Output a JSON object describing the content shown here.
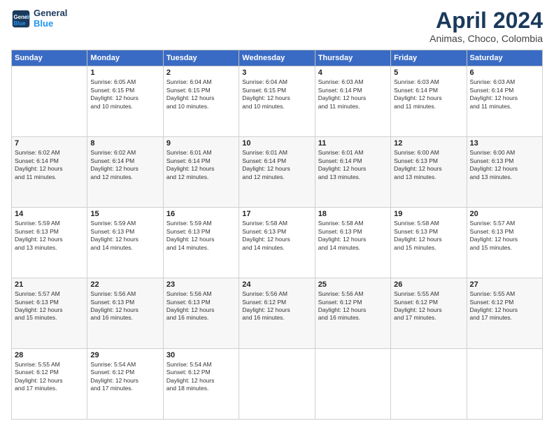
{
  "header": {
    "logo_line1": "General",
    "logo_line2": "Blue",
    "month_year": "April 2024",
    "location": "Animas, Choco, Colombia"
  },
  "columns": [
    "Sunday",
    "Monday",
    "Tuesday",
    "Wednesday",
    "Thursday",
    "Friday",
    "Saturday"
  ],
  "weeks": [
    [
      {
        "day": "",
        "content": ""
      },
      {
        "day": "1",
        "content": "Sunrise: 6:05 AM\nSunset: 6:15 PM\nDaylight: 12 hours\nand 10 minutes."
      },
      {
        "day": "2",
        "content": "Sunrise: 6:04 AM\nSunset: 6:15 PM\nDaylight: 12 hours\nand 10 minutes."
      },
      {
        "day": "3",
        "content": "Sunrise: 6:04 AM\nSunset: 6:15 PM\nDaylight: 12 hours\nand 10 minutes."
      },
      {
        "day": "4",
        "content": "Sunrise: 6:03 AM\nSunset: 6:14 PM\nDaylight: 12 hours\nand 11 minutes."
      },
      {
        "day": "5",
        "content": "Sunrise: 6:03 AM\nSunset: 6:14 PM\nDaylight: 12 hours\nand 11 minutes."
      },
      {
        "day": "6",
        "content": "Sunrise: 6:03 AM\nSunset: 6:14 PM\nDaylight: 12 hours\nand 11 minutes."
      }
    ],
    [
      {
        "day": "7",
        "content": "Sunrise: 6:02 AM\nSunset: 6:14 PM\nDaylight: 12 hours\nand 11 minutes."
      },
      {
        "day": "8",
        "content": "Sunrise: 6:02 AM\nSunset: 6:14 PM\nDaylight: 12 hours\nand 12 minutes."
      },
      {
        "day": "9",
        "content": "Sunrise: 6:01 AM\nSunset: 6:14 PM\nDaylight: 12 hours\nand 12 minutes."
      },
      {
        "day": "10",
        "content": "Sunrise: 6:01 AM\nSunset: 6:14 PM\nDaylight: 12 hours\nand 12 minutes."
      },
      {
        "day": "11",
        "content": "Sunrise: 6:01 AM\nSunset: 6:14 PM\nDaylight: 12 hours\nand 13 minutes."
      },
      {
        "day": "12",
        "content": "Sunrise: 6:00 AM\nSunset: 6:13 PM\nDaylight: 12 hours\nand 13 minutes."
      },
      {
        "day": "13",
        "content": "Sunrise: 6:00 AM\nSunset: 6:13 PM\nDaylight: 12 hours\nand 13 minutes."
      }
    ],
    [
      {
        "day": "14",
        "content": "Sunrise: 5:59 AM\nSunset: 6:13 PM\nDaylight: 12 hours\nand 13 minutes."
      },
      {
        "day": "15",
        "content": "Sunrise: 5:59 AM\nSunset: 6:13 PM\nDaylight: 12 hours\nand 14 minutes."
      },
      {
        "day": "16",
        "content": "Sunrise: 5:59 AM\nSunset: 6:13 PM\nDaylight: 12 hours\nand 14 minutes."
      },
      {
        "day": "17",
        "content": "Sunrise: 5:58 AM\nSunset: 6:13 PM\nDaylight: 12 hours\nand 14 minutes."
      },
      {
        "day": "18",
        "content": "Sunrise: 5:58 AM\nSunset: 6:13 PM\nDaylight: 12 hours\nand 14 minutes."
      },
      {
        "day": "19",
        "content": "Sunrise: 5:58 AM\nSunset: 6:13 PM\nDaylight: 12 hours\nand 15 minutes."
      },
      {
        "day": "20",
        "content": "Sunrise: 5:57 AM\nSunset: 6:13 PM\nDaylight: 12 hours\nand 15 minutes."
      }
    ],
    [
      {
        "day": "21",
        "content": "Sunrise: 5:57 AM\nSunset: 6:13 PM\nDaylight: 12 hours\nand 15 minutes."
      },
      {
        "day": "22",
        "content": "Sunrise: 5:56 AM\nSunset: 6:13 PM\nDaylight: 12 hours\nand 16 minutes."
      },
      {
        "day": "23",
        "content": "Sunrise: 5:56 AM\nSunset: 6:13 PM\nDaylight: 12 hours\nand 16 minutes."
      },
      {
        "day": "24",
        "content": "Sunrise: 5:56 AM\nSunset: 6:12 PM\nDaylight: 12 hours\nand 16 minutes."
      },
      {
        "day": "25",
        "content": "Sunrise: 5:56 AM\nSunset: 6:12 PM\nDaylight: 12 hours\nand 16 minutes."
      },
      {
        "day": "26",
        "content": "Sunrise: 5:55 AM\nSunset: 6:12 PM\nDaylight: 12 hours\nand 17 minutes."
      },
      {
        "day": "27",
        "content": "Sunrise: 5:55 AM\nSunset: 6:12 PM\nDaylight: 12 hours\nand 17 minutes."
      }
    ],
    [
      {
        "day": "28",
        "content": "Sunrise: 5:55 AM\nSunset: 6:12 PM\nDaylight: 12 hours\nand 17 minutes."
      },
      {
        "day": "29",
        "content": "Sunrise: 5:54 AM\nSunset: 6:12 PM\nDaylight: 12 hours\nand 17 minutes."
      },
      {
        "day": "30",
        "content": "Sunrise: 5:54 AM\nSunset: 6:12 PM\nDaylight: 12 hours\nand 18 minutes."
      },
      {
        "day": "",
        "content": ""
      },
      {
        "day": "",
        "content": ""
      },
      {
        "day": "",
        "content": ""
      },
      {
        "day": "",
        "content": ""
      }
    ]
  ]
}
